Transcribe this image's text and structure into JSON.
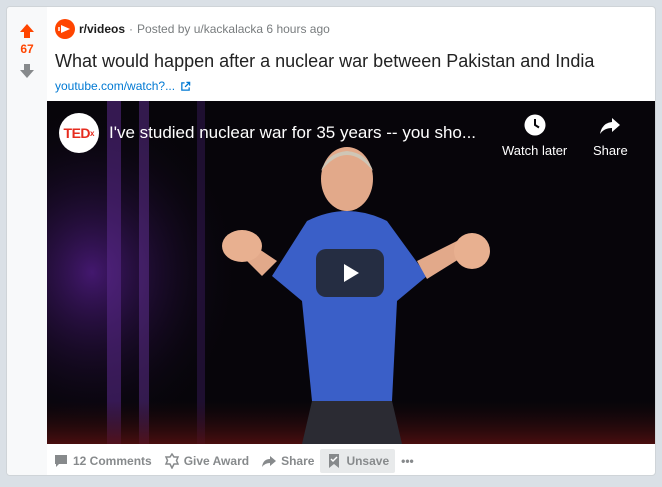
{
  "post": {
    "score": "67",
    "subreddit": "r/videos",
    "posted_by": "Posted by u/kackalacka 6 hours ago",
    "separator": "·",
    "title": "What would happen after a nuclear war between Pakistan and India",
    "link_text": "youtube.com/watch?...",
    "accent_color": "#ff4500",
    "link_color": "#0079d3"
  },
  "video": {
    "channel_logo_text": "TED",
    "channel_logo_sup": "x",
    "title": "I've studied nuclear war for 35 years -- you sho...",
    "watch_later_label": "Watch later",
    "share_label": "Share",
    "icons": [
      "clock-icon",
      "share-arrow-icon",
      "play-icon"
    ]
  },
  "actions": {
    "comments_label": "12 Comments",
    "award_label": "Give Award",
    "share_label": "Share",
    "unsave_label": "Unsave",
    "more_label": "•••"
  }
}
